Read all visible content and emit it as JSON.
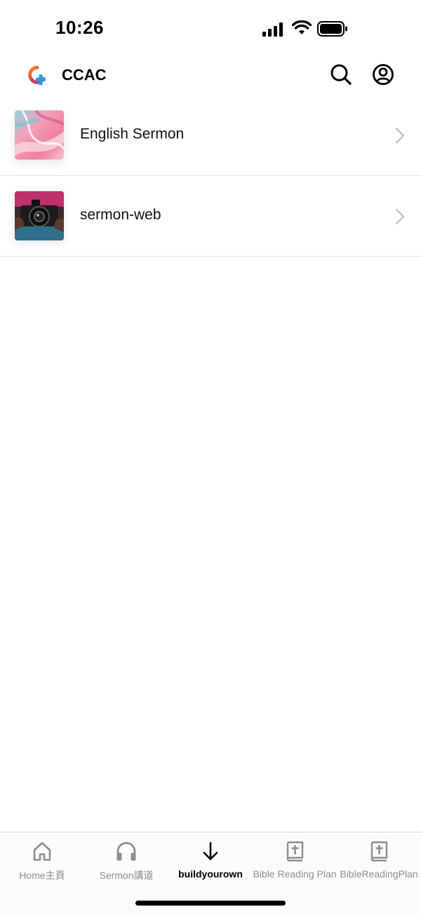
{
  "status_bar": {
    "time": "10:26",
    "icons": [
      "cellular-signal-icon",
      "wifi-icon",
      "battery-icon"
    ]
  },
  "header": {
    "title": "CCAC",
    "logo_icon": "ccac-logo-icon",
    "actions": [
      "search-icon",
      "account-icon"
    ]
  },
  "list": {
    "items": [
      {
        "label": "English Sermon",
        "thumbnail": "pink-marble-artwork"
      },
      {
        "label": "sermon-web",
        "thumbnail": "camera-photo"
      }
    ]
  },
  "tab_bar": {
    "tabs": [
      {
        "label": "Home主頁",
        "icon": "home-icon",
        "active": false
      },
      {
        "label": "Sermon講道",
        "icon": "headphones-icon",
        "active": false
      },
      {
        "label": "buildyourown",
        "icon": "arrow-down-icon",
        "active": true
      },
      {
        "label": "Bible Reading Plan",
        "icon": "bible-icon",
        "active": false
      },
      {
        "label": "BibleReadingPlan",
        "icon": "bible-icon",
        "active": false
      }
    ]
  },
  "colors": {
    "active_tab": "#000000",
    "inactive_tab": "#8e8e8e",
    "divider": "#e3e3e3",
    "logo_red": "#e8384f",
    "logo_blue": "#2a9fd8"
  }
}
